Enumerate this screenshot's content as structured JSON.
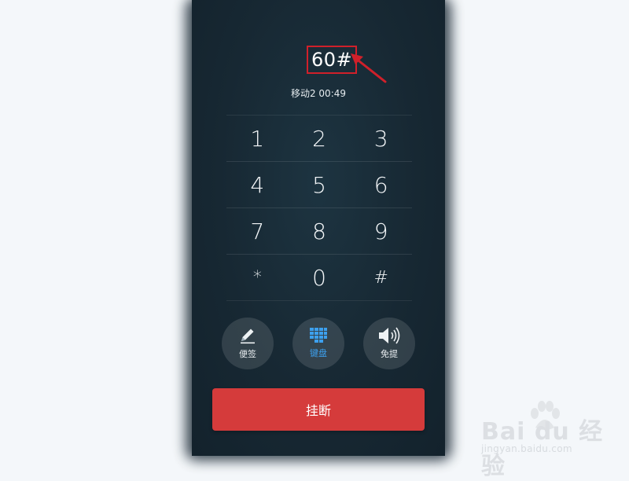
{
  "dialer": {
    "dialed_number": "60#",
    "call_info": "移动2 00:49"
  },
  "keypad": {
    "rows": [
      [
        "1",
        "2",
        "3"
      ],
      [
        "4",
        "5",
        "6"
      ],
      [
        "7",
        "8",
        "9"
      ],
      [
        "*",
        "0",
        "#"
      ]
    ]
  },
  "actions": {
    "notes_label": "便签",
    "keypad_label": "键盘",
    "speaker_label": "免提"
  },
  "hangup_label": "挂断",
  "watermark": {
    "main": "Bai du 经验",
    "sub": "jingyan.baidu.com"
  },
  "colors": {
    "annotation_red": "#d0202a",
    "hangup_red": "#d53b3b",
    "active_blue": "#3da0ee"
  }
}
